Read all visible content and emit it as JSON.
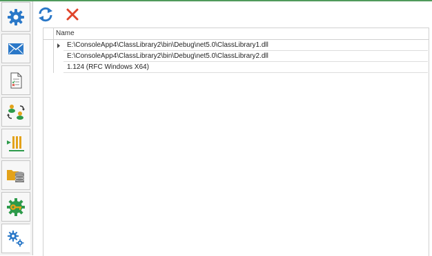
{
  "sidebar": {
    "items": [
      {
        "icon": "gear-icon",
        "color": "#2a78c8"
      },
      {
        "icon": "envelope-icon",
        "color": "#2a78c8"
      },
      {
        "icon": "document-checklist-icon",
        "color": "#333333"
      },
      {
        "icon": "people-sync-icon",
        "color": "#2d9a4a"
      },
      {
        "icon": "bars-import-icon",
        "color": "#e3a21a"
      },
      {
        "icon": "folder-database-icon",
        "color": "#e3a21a"
      },
      {
        "icon": "key-gear-icon",
        "color": "#2d9a4a"
      },
      {
        "icon": "settings-gears-icon",
        "color": "#2a78c8",
        "active": true
      }
    ]
  },
  "toolbar": {
    "refresh_icon": "refresh-icon",
    "close_icon": "close-icon",
    "refresh_color": "#2a78c8",
    "close_color": "#e0442a"
  },
  "grid": {
    "columns": [
      "Name"
    ],
    "root_expanded": false,
    "rows": [
      "E:\\ConsoleApp4\\ClassLibrary2\\bin\\Debug\\net5.0\\ClassLibrary1.dll",
      "E:\\ConsoleApp4\\ClassLibrary2\\bin\\Debug\\net5.0\\ClassLibrary2.dll",
      "1.124 (RFC Windows X64)"
    ]
  }
}
